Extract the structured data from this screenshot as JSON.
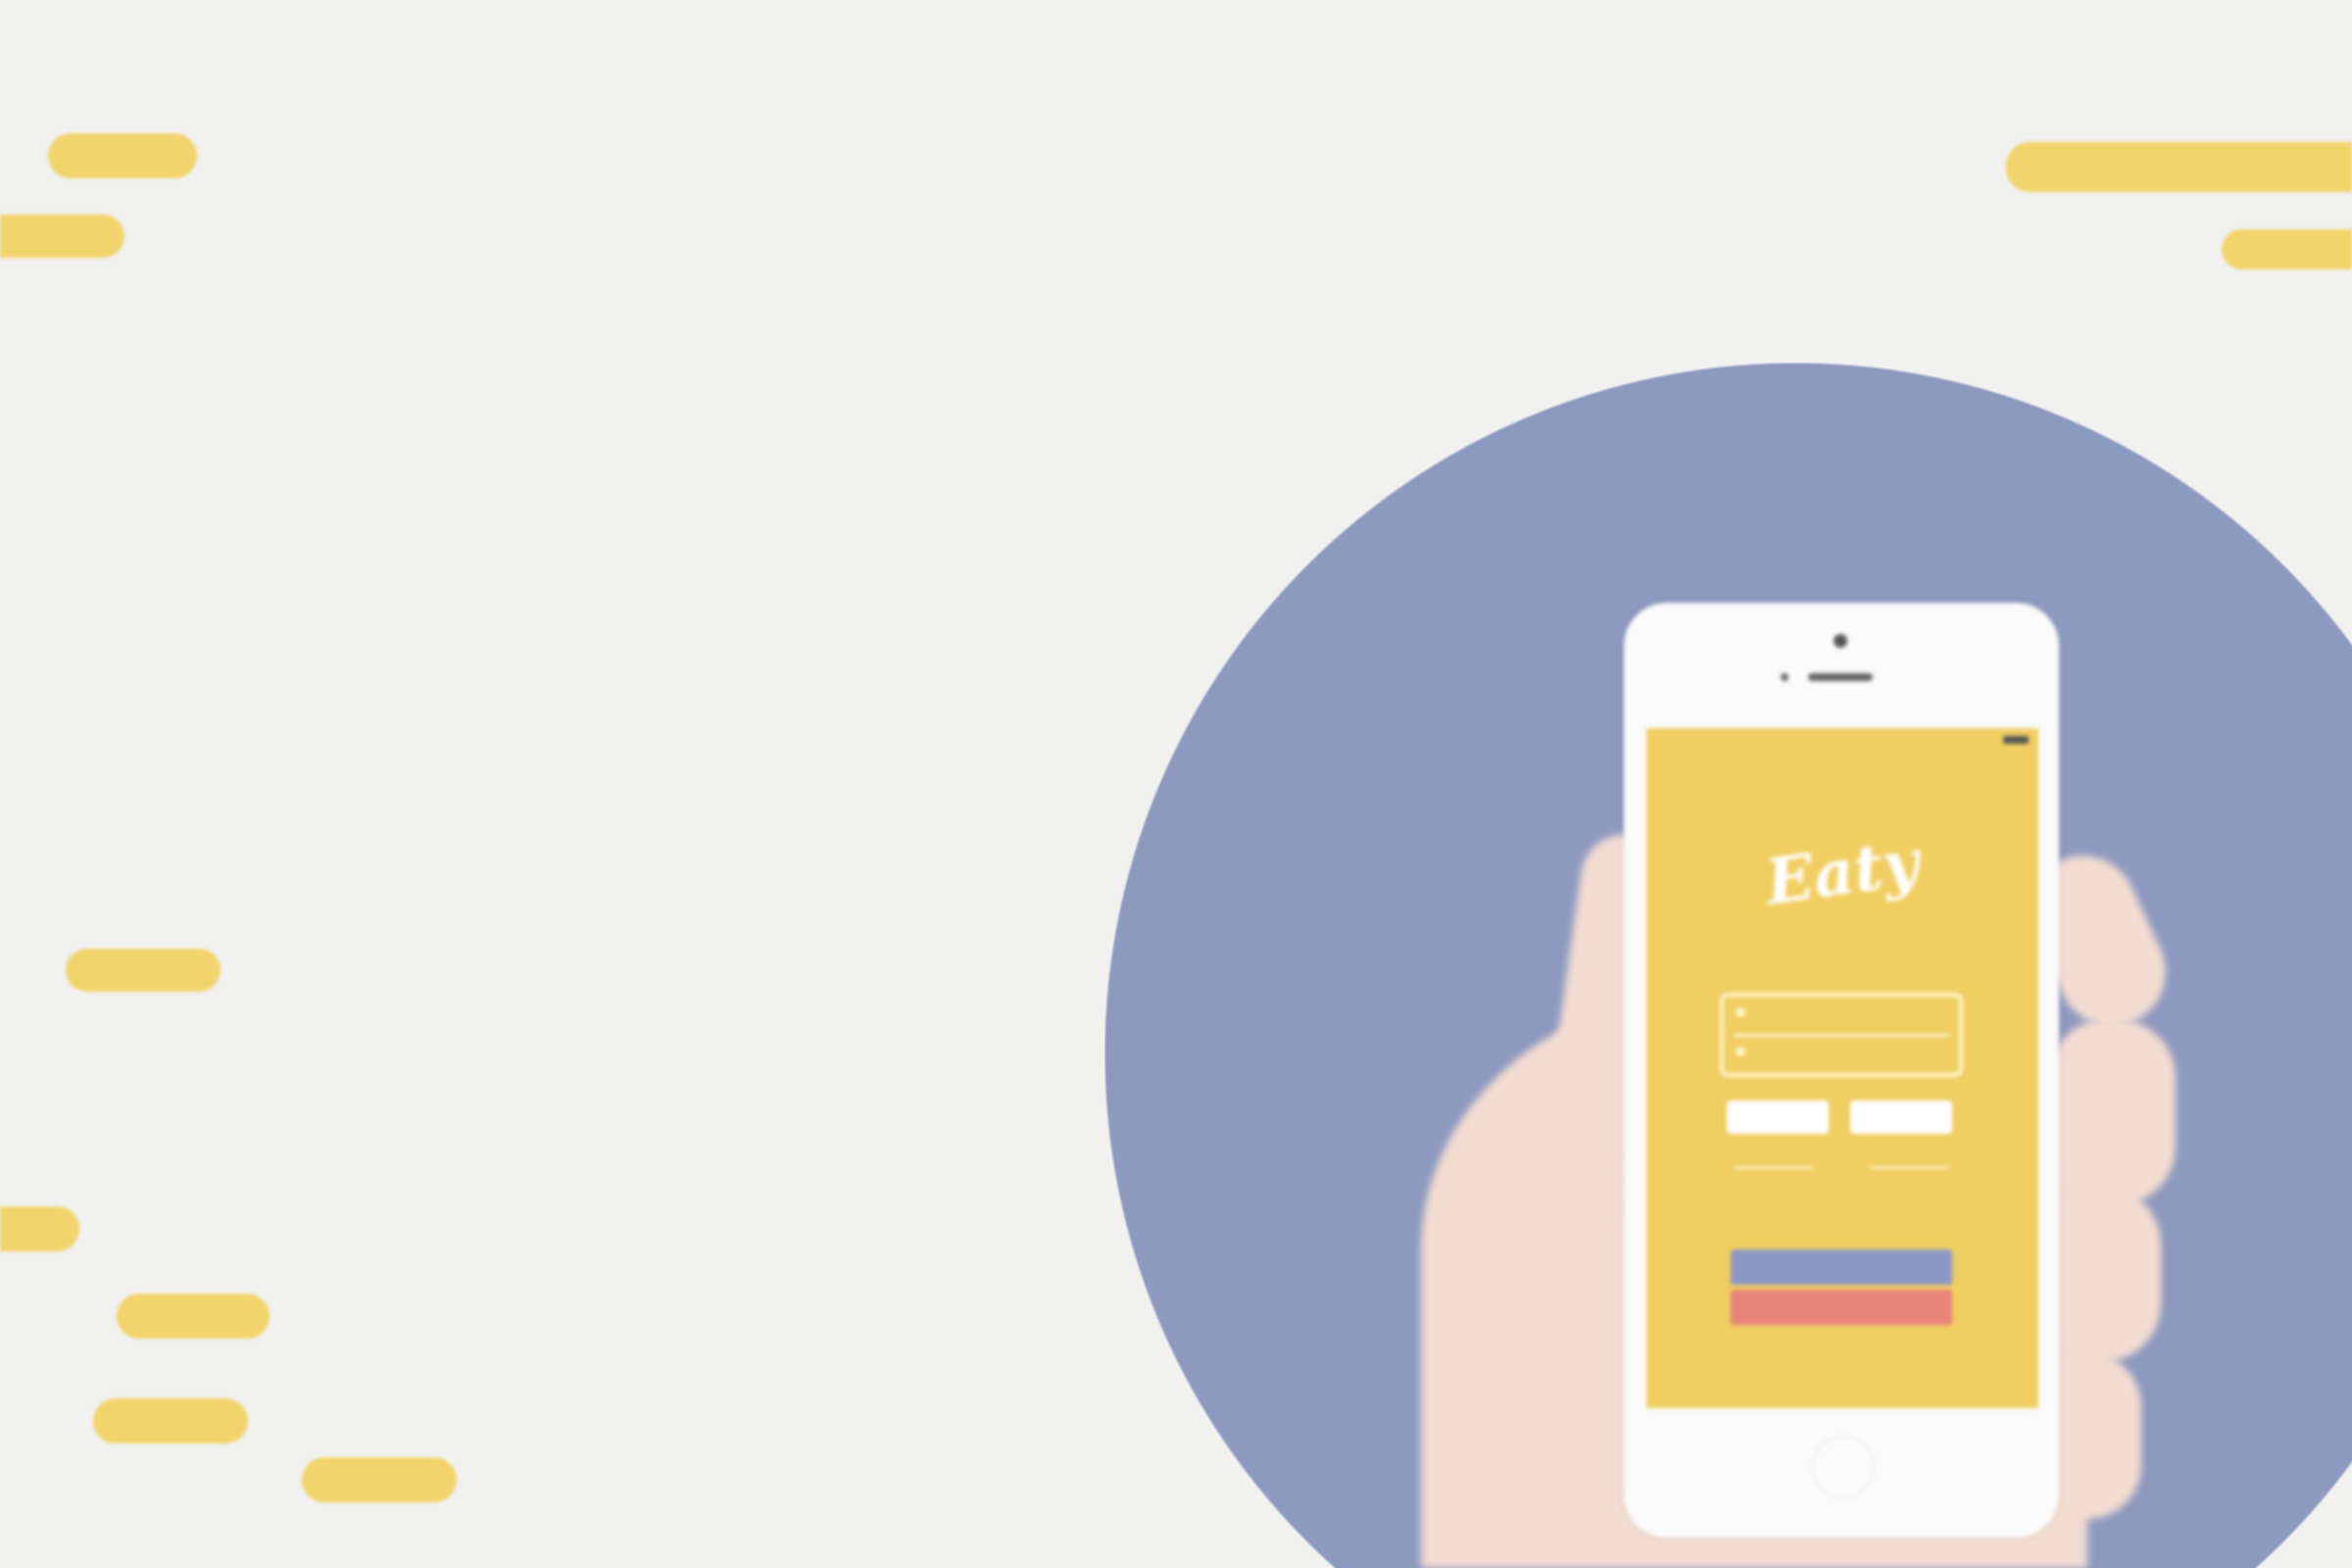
{
  "colors": {
    "background": "#f1f1f0",
    "accent_yellow": "#f2d46c",
    "circle": "#8e99bf",
    "screen": "#f0ce62"
  },
  "phone_app": {
    "logo": "Eaty",
    "status_time": "",
    "username_placeholder": "",
    "password_placeholder": "",
    "login_label": "",
    "signup_label": "",
    "or_label": "",
    "facebook_label": "",
    "google_label": ""
  }
}
